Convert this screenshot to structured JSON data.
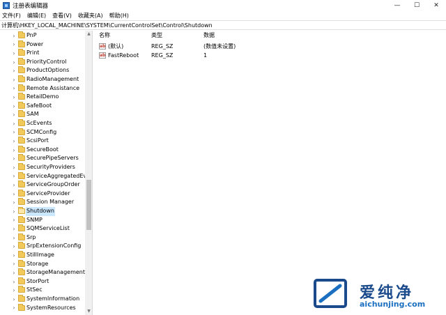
{
  "window": {
    "title": "注册表编辑器",
    "minimize": "—",
    "maximize": "☐",
    "close": "✕"
  },
  "menu": [
    "文件(F)",
    "编辑(E)",
    "查看(V)",
    "收藏夹(A)",
    "帮助(H)"
  ],
  "address": "计算机\\HKEY_LOCAL_MACHINE\\SYSTEM\\CurrentControlSet\\Control\\Shutdown",
  "tree": {
    "items": [
      "PnP",
      "Power",
      "Print",
      "PriorityControl",
      "ProductOptions",
      "RadioManagement",
      "Remote Assistance",
      "RetailDemo",
      "SafeBoot",
      "SAM",
      "ScEvents",
      "SCMConfig",
      "ScsiPort",
      "SecureBoot",
      "SecurePipeServers",
      "SecurityProviders",
      "ServiceAggregatedEver",
      "ServiceGroupOrder",
      "ServiceProvider",
      "Session Manager",
      "Shutdown",
      "SNMP",
      "SQMServiceList",
      "Srp",
      "SrpExtensionConfig",
      "StillImage",
      "Storage",
      "StorageManagement",
      "StorPort",
      "StSec",
      "SystemInformation",
      "SystemResources"
    ],
    "selected_index": 20
  },
  "list": {
    "headers": {
      "name": "名称",
      "type": "类型",
      "data": "数据"
    },
    "rows": [
      {
        "name": "(默认)",
        "type": "REG_SZ",
        "data": "(数值未设置)"
      },
      {
        "name": "FastReboot",
        "type": "REG_SZ",
        "data": "1"
      }
    ]
  },
  "watermark": {
    "cn": "爱纯净",
    "en": "aichunjing.com"
  },
  "colors": {
    "selection": "#cce8ff",
    "folder": "#f2ca5b",
    "watermark_blue": "#1b4a8c"
  }
}
